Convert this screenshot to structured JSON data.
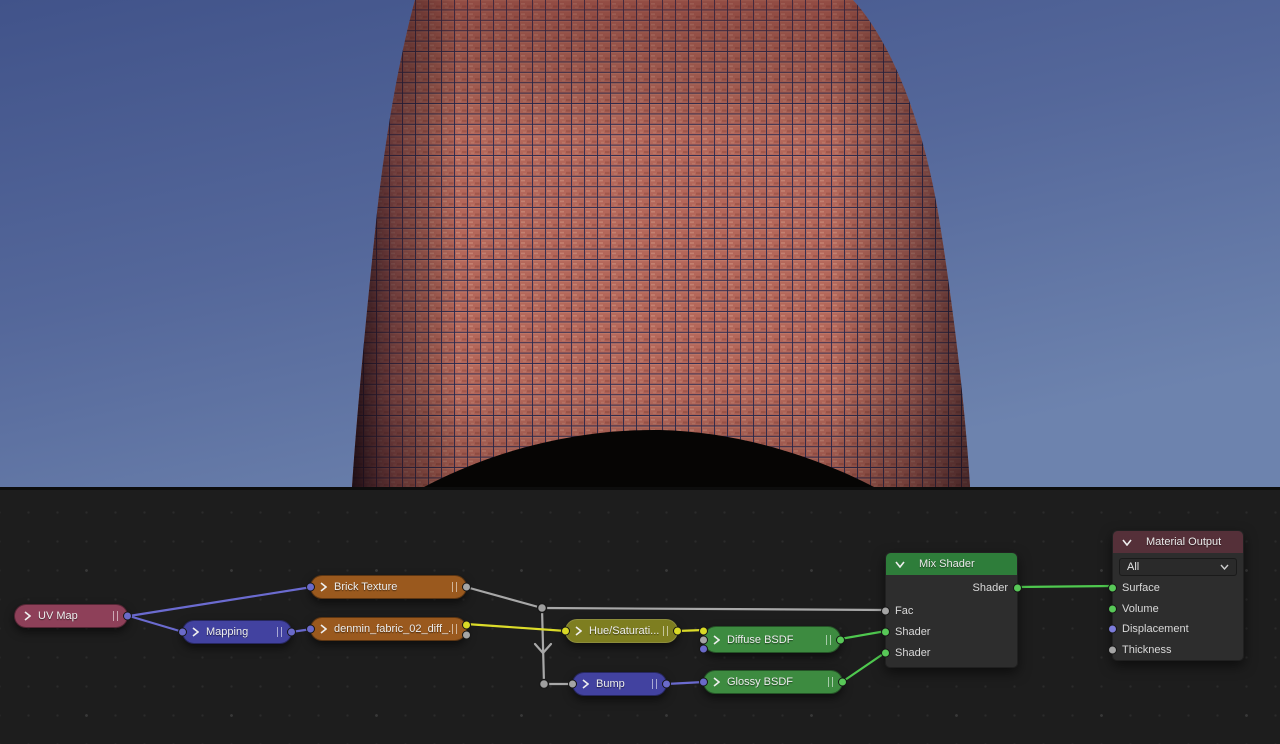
{
  "editor": {
    "nodes": [
      {
        "id": "uv-map",
        "label": "UV Map"
      },
      {
        "id": "mapping",
        "label": "Mapping"
      },
      {
        "id": "brick-texture",
        "label": "Brick Texture"
      },
      {
        "id": "image-texture",
        "label": "denmin_fabric_02_diff_..."
      },
      {
        "id": "hue-saturation",
        "label": "Hue/Saturati..."
      },
      {
        "id": "bump",
        "label": "Bump"
      },
      {
        "id": "diffuse-bsdf",
        "label": "Diffuse BSDF"
      },
      {
        "id": "glossy-bsdf",
        "label": "Glossy BSDF"
      }
    ],
    "mix_shader": {
      "title": "Mix Shader",
      "output_label": "Shader",
      "input_fac": "Fac",
      "input_shader1": "Shader",
      "input_shader2": "Shader"
    },
    "material_output": {
      "title": "Material Output",
      "target_value": "All",
      "input_surface": "Surface",
      "input_volume": "Volume",
      "input_displacement": "Displacement",
      "input_thickness": "Thickness"
    }
  },
  "colors": {
    "sky_top": "#41538a",
    "sky_mid": "#54679a",
    "sky_bottom": "#6d83ae",
    "brick_base": "#b4675a",
    "brick_light": "#c98a79",
    "brick_dark": "#9c5347",
    "mortar": "#2a2a50",
    "under_shadow": "#060504",
    "wire_purple": "#6b6bd0",
    "wire_gray": "#a8a8a8",
    "wire_yellow": "#dcdc2a",
    "wire_green": "#4fc94f",
    "node_uv_map": "#8e4059",
    "node_vector": "#4242a0",
    "node_texture": "#9a591e",
    "node_color_adjust": "#7e7e20",
    "node_shader_green": "#3d8b40",
    "mix_shader_header": "#2e7d3a",
    "material_output_header": "#553039"
  }
}
